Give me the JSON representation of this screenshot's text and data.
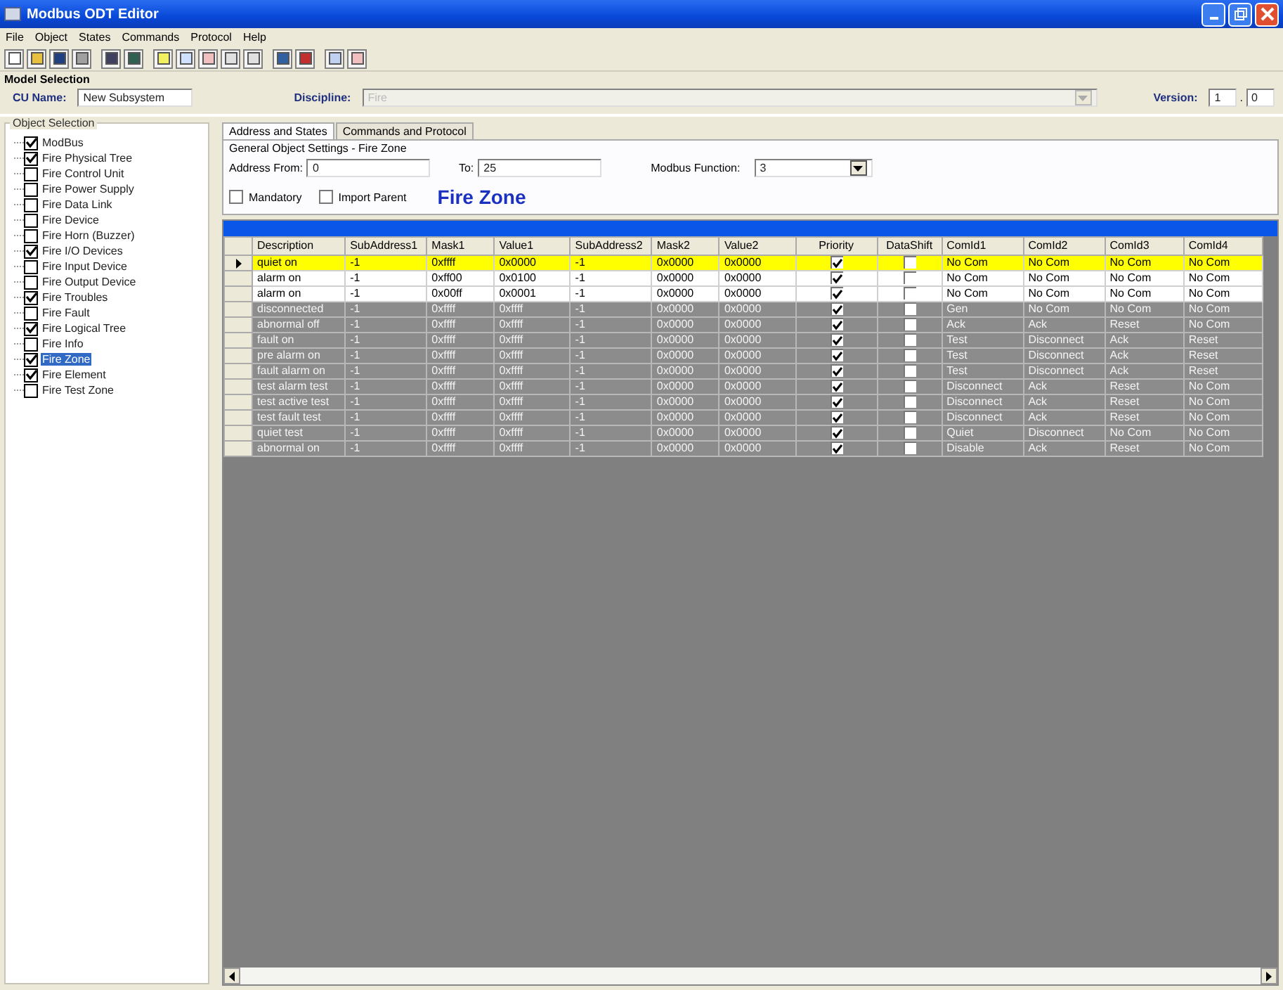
{
  "window": {
    "title": "Modbus ODT Editor"
  },
  "menu": [
    "File",
    "Object",
    "States",
    "Commands",
    "Protocol",
    "Help"
  ],
  "model_selection": {
    "title": "Model Selection",
    "cu_name_label": "CU Name:",
    "cu_name": "New Subsystem",
    "discipline_label": "Discipline:",
    "discipline": "Fire",
    "version_label": "Version:",
    "version_major": "1",
    "version_separator": ".",
    "version_minor": "0"
  },
  "object_selection": {
    "title": "Object Selection",
    "items": [
      {
        "label": "ModBus",
        "checked": true,
        "selected": false
      },
      {
        "label": "Fire Physical Tree",
        "checked": true,
        "selected": false
      },
      {
        "label": "Fire Control Unit",
        "checked": false,
        "selected": false
      },
      {
        "label": "Fire Power Supply",
        "checked": false,
        "selected": false
      },
      {
        "label": "Fire Data Link",
        "checked": false,
        "selected": false
      },
      {
        "label": "Fire Device",
        "checked": false,
        "selected": false
      },
      {
        "label": "Fire Horn (Buzzer)",
        "checked": false,
        "selected": false
      },
      {
        "label": "Fire I/O Devices",
        "checked": true,
        "selected": false
      },
      {
        "label": "Fire Input Device",
        "checked": false,
        "selected": false
      },
      {
        "label": "Fire Output Device",
        "checked": false,
        "selected": false
      },
      {
        "label": "Fire Troubles",
        "checked": true,
        "selected": false
      },
      {
        "label": "Fire Fault",
        "checked": false,
        "selected": false
      },
      {
        "label": "Fire Logical Tree",
        "checked": true,
        "selected": false
      },
      {
        "label": "Fire Info",
        "checked": false,
        "selected": false
      },
      {
        "label": "Fire Zone",
        "checked": true,
        "selected": true
      },
      {
        "label": "Fire Element",
        "checked": true,
        "selected": false
      },
      {
        "label": "Fire Test Zone",
        "checked": false,
        "selected": false
      }
    ]
  },
  "tabs": [
    {
      "label": "Address and States",
      "selected": true
    },
    {
      "label": "Commands and Protocol",
      "selected": false
    }
  ],
  "settings": {
    "title": "General Object Settings - Fire Zone",
    "address_from_label": "Address From:",
    "address_from": "0",
    "to_label": "To:",
    "to": "25",
    "modbus_function_label": "Modbus Function:",
    "modbus_function": "3",
    "mandatory": {
      "label": "Mandatory",
      "checked": false
    },
    "import_parent": {
      "label": "Import Parent",
      "checked": false
    },
    "heading": "Fire Zone"
  },
  "table": {
    "columns": [
      "Description",
      "SubAddress1",
      "Mask1",
      "Value1",
      "SubAddress2",
      "Mask2",
      "Value2",
      "Priority",
      "DataShift",
      "ComId1",
      "ComId2",
      "ComId3",
      "ComId4"
    ],
    "rows": [
      {
        "selected": true,
        "disabled": false,
        "current": true,
        "description": "quiet on",
        "sub1": "-1",
        "mask1": "0xffff",
        "value1": "0x0000",
        "sub2": "-1",
        "mask2": "0x0000",
        "value2": "0x0000",
        "priority": true,
        "datashift": false,
        "com": [
          "No Com",
          "No Com",
          "No Com",
          "No Com"
        ]
      },
      {
        "selected": false,
        "disabled": false,
        "current": false,
        "description": "alarm on",
        "sub1": "-1",
        "mask1": "0xff00",
        "value1": "0x0100",
        "sub2": "-1",
        "mask2": "0x0000",
        "value2": "0x0000",
        "priority": true,
        "datashift": false,
        "com": [
          "No Com",
          "No Com",
          "No Com",
          "No Com"
        ]
      },
      {
        "selected": false,
        "disabled": false,
        "current": false,
        "description": "alarm on",
        "sub1": "-1",
        "mask1": "0x00ff",
        "value1": "0x0001",
        "sub2": "-1",
        "mask2": "0x0000",
        "value2": "0x0000",
        "priority": true,
        "datashift": false,
        "com": [
          "No Com",
          "No Com",
          "No Com",
          "No Com"
        ]
      },
      {
        "selected": false,
        "disabled": true,
        "current": false,
        "description": "disconnected",
        "sub1": "-1",
        "mask1": "0xffff",
        "value1": "0xffff",
        "sub2": "-1",
        "mask2": "0x0000",
        "value2": "0x0000",
        "priority": true,
        "datashift": false,
        "com": [
          "Gen",
          "No Com",
          "No Com",
          "No Com"
        ]
      },
      {
        "selected": false,
        "disabled": true,
        "current": false,
        "description": "abnormal off",
        "sub1": "-1",
        "mask1": "0xffff",
        "value1": "0xffff",
        "sub2": "-1",
        "mask2": "0x0000",
        "value2": "0x0000",
        "priority": true,
        "datashift": false,
        "com": [
          "Ack",
          "Ack",
          "Reset",
          "No Com"
        ]
      },
      {
        "selected": false,
        "disabled": true,
        "current": false,
        "description": "fault on",
        "sub1": "-1",
        "mask1": "0xffff",
        "value1": "0xffff",
        "sub2": "-1",
        "mask2": "0x0000",
        "value2": "0x0000",
        "priority": true,
        "datashift": false,
        "com": [
          "Test",
          "Disconnect",
          "Ack",
          "Reset"
        ]
      },
      {
        "selected": false,
        "disabled": true,
        "current": false,
        "description": "pre alarm on",
        "sub1": "-1",
        "mask1": "0xffff",
        "value1": "0xffff",
        "sub2": "-1",
        "mask2": "0x0000",
        "value2": "0x0000",
        "priority": true,
        "datashift": false,
        "com": [
          "Test",
          "Disconnect",
          "Ack",
          "Reset"
        ]
      },
      {
        "selected": false,
        "disabled": true,
        "current": false,
        "description": "fault alarm on",
        "sub1": "-1",
        "mask1": "0xffff",
        "value1": "0xffff",
        "sub2": "-1",
        "mask2": "0x0000",
        "value2": "0x0000",
        "priority": true,
        "datashift": false,
        "com": [
          "Test",
          "Disconnect",
          "Ack",
          "Reset"
        ]
      },
      {
        "selected": false,
        "disabled": true,
        "current": false,
        "description": "test alarm test",
        "sub1": "-1",
        "mask1": "0xffff",
        "value1": "0xffff",
        "sub2": "-1",
        "mask2": "0x0000",
        "value2": "0x0000",
        "priority": true,
        "datashift": false,
        "com": [
          "Disconnect",
          "Ack",
          "Reset",
          "No Com"
        ]
      },
      {
        "selected": false,
        "disabled": true,
        "current": false,
        "description": "test active test",
        "sub1": "-1",
        "mask1": "0xffff",
        "value1": "0xffff",
        "sub2": "-1",
        "mask2": "0x0000",
        "value2": "0x0000",
        "priority": true,
        "datashift": false,
        "com": [
          "Disconnect",
          "Ack",
          "Reset",
          "No Com"
        ]
      },
      {
        "selected": false,
        "disabled": true,
        "current": false,
        "description": "test fault test",
        "sub1": "-1",
        "mask1": "0xffff",
        "value1": "0xffff",
        "sub2": "-1",
        "mask2": "0x0000",
        "value2": "0x0000",
        "priority": true,
        "datashift": false,
        "com": [
          "Disconnect",
          "Ack",
          "Reset",
          "No Com"
        ]
      },
      {
        "selected": false,
        "disabled": true,
        "current": false,
        "description": "quiet test",
        "sub1": "-1",
        "mask1": "0xffff",
        "value1": "0xffff",
        "sub2": "-1",
        "mask2": "0x0000",
        "value2": "0x0000",
        "priority": true,
        "datashift": false,
        "com": [
          "Quiet",
          "Disconnect",
          "No Com",
          "No Com"
        ]
      },
      {
        "selected": false,
        "disabled": true,
        "current": false,
        "description": "abnormal on",
        "sub1": "-1",
        "mask1": "0xffff",
        "value1": "0xffff",
        "sub2": "-1",
        "mask2": "0x0000",
        "value2": "0x0000",
        "priority": true,
        "datashift": false,
        "com": [
          "Disable",
          "Ack",
          "Reset",
          "No Com"
        ]
      }
    ]
  }
}
